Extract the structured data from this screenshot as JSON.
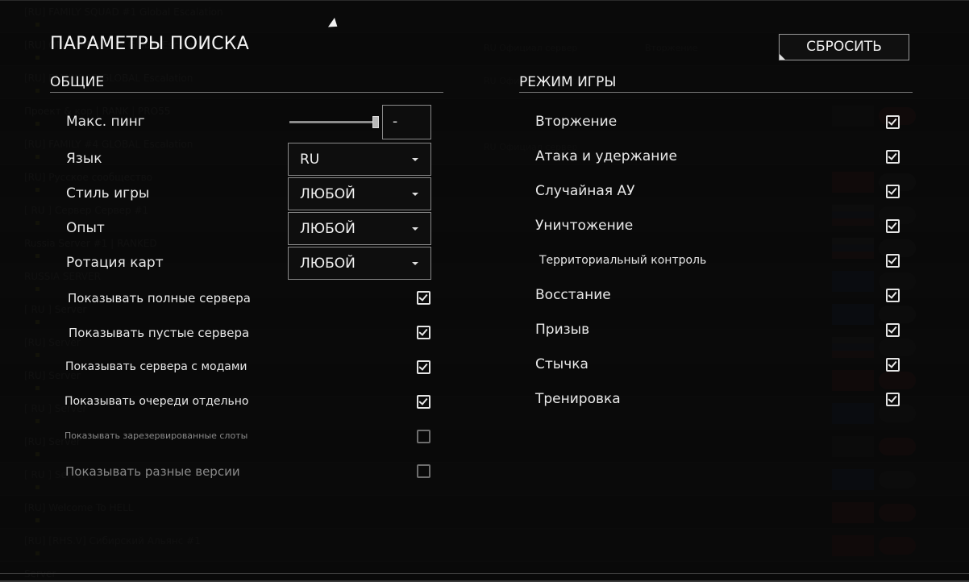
{
  "title": "ПАРАМЕТРЫ ПОИСКА",
  "reset_button": "СБРОСИТЬ",
  "general": {
    "heading": "ОБЩИЕ",
    "max_ping_label": "Макс. пинг",
    "max_ping_value": "-",
    "max_ping_slider_fraction": 1.0,
    "language_label": "Язык",
    "language_value": "RU",
    "game_style_label": "Стиль игры",
    "game_style_value": "ЛЮБОЙ",
    "experience_label": "Опыт",
    "experience_value": "ЛЮБОЙ",
    "map_rotation_label": "Ротация карт",
    "map_rotation_value": "ЛЮБОЙ",
    "options": [
      {
        "label": "Показывать полные сервера",
        "checked": true
      },
      {
        "label": "Показывать пустые сервера",
        "checked": true
      },
      {
        "label": "Показывать сервера с модами",
        "checked": true
      },
      {
        "label": "Показывать очереди отдельно",
        "checked": true
      },
      {
        "label": "Показывать зарезервированные слоты",
        "checked": false
      },
      {
        "label": "Показывать разные версии",
        "checked": false
      }
    ]
  },
  "game_modes": {
    "heading": "РЕЖИМ ИГРЫ",
    "modes": [
      {
        "label": "Вторжение",
        "checked": true
      },
      {
        "label": "Атака и удержание",
        "checked": true
      },
      {
        "label": "Случайная АУ",
        "checked": true
      },
      {
        "label": "Уничтожение",
        "checked": true
      },
      {
        "label": "Территориальный контроль",
        "checked": true
      },
      {
        "label": "Восстание",
        "checked": true
      },
      {
        "label": "Призыв",
        "checked": true
      },
      {
        "label": "Стычка",
        "checked": true
      },
      {
        "label": "Тренировка",
        "checked": true
      }
    ]
  },
  "colors": {
    "background": "#0b0b0b",
    "text": "#e8e8e8",
    "border": "#8a8a8a",
    "disabled_text": "#8a8a8a"
  }
}
